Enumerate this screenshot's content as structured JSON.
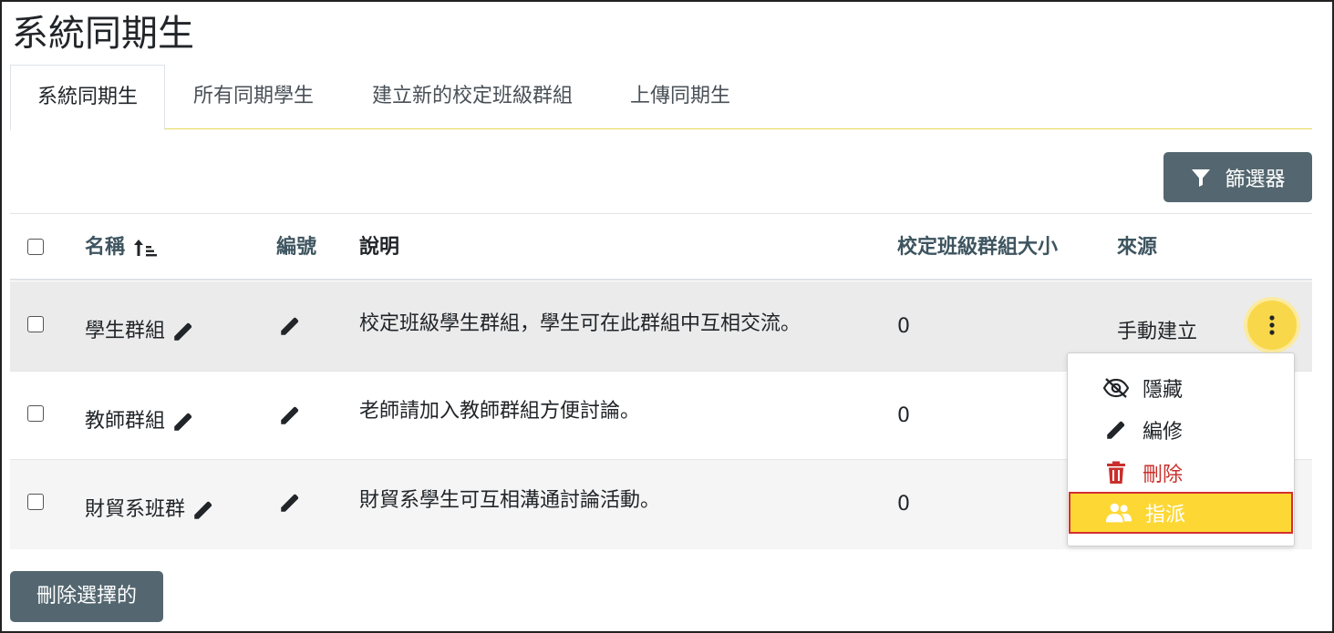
{
  "page": {
    "title": "系統同期生"
  },
  "tabs": [
    {
      "label": "系統同期生",
      "active": true
    },
    {
      "label": "所有同期學生",
      "active": false
    },
    {
      "label": "建立新的校定班級群組",
      "active": false
    },
    {
      "label": "上傳同期生",
      "active": false
    }
  ],
  "toolbar": {
    "filter_label": "篩選器",
    "filter_icon": "filter-icon"
  },
  "table": {
    "columns": [
      "名稱",
      "編號",
      "說明",
      "校定班級群組大小",
      "來源"
    ],
    "rows": [
      {
        "name": "學生群組",
        "description": "校定班級學生群組，學生可在此群組中互相交流。",
        "size": "0",
        "source": "手動建立"
      },
      {
        "name": "教師群組",
        "description": "老師請加入教師群組方便討論。",
        "size": "0",
        "source": ""
      },
      {
        "name": "財貿系班群",
        "description": "財貿系學生可互相溝通討論活動。",
        "size": "0",
        "source": ""
      }
    ]
  },
  "row_menu": {
    "items": [
      {
        "label": "隱藏",
        "icon": "eye-slash-icon"
      },
      {
        "label": "編修",
        "icon": "pencil-icon"
      },
      {
        "label": "刪除",
        "icon": "trash-icon"
      },
      {
        "label": "指派",
        "icon": "users-icon"
      }
    ]
  },
  "footer": {
    "delete_selected_label": "刪除選擇的"
  },
  "colors": {
    "accent_yellow": "#fdd835",
    "button_slate": "#546770",
    "header_link": "#3e5560",
    "danger": "#c9302c",
    "highlight_border": "#d32f2f"
  }
}
